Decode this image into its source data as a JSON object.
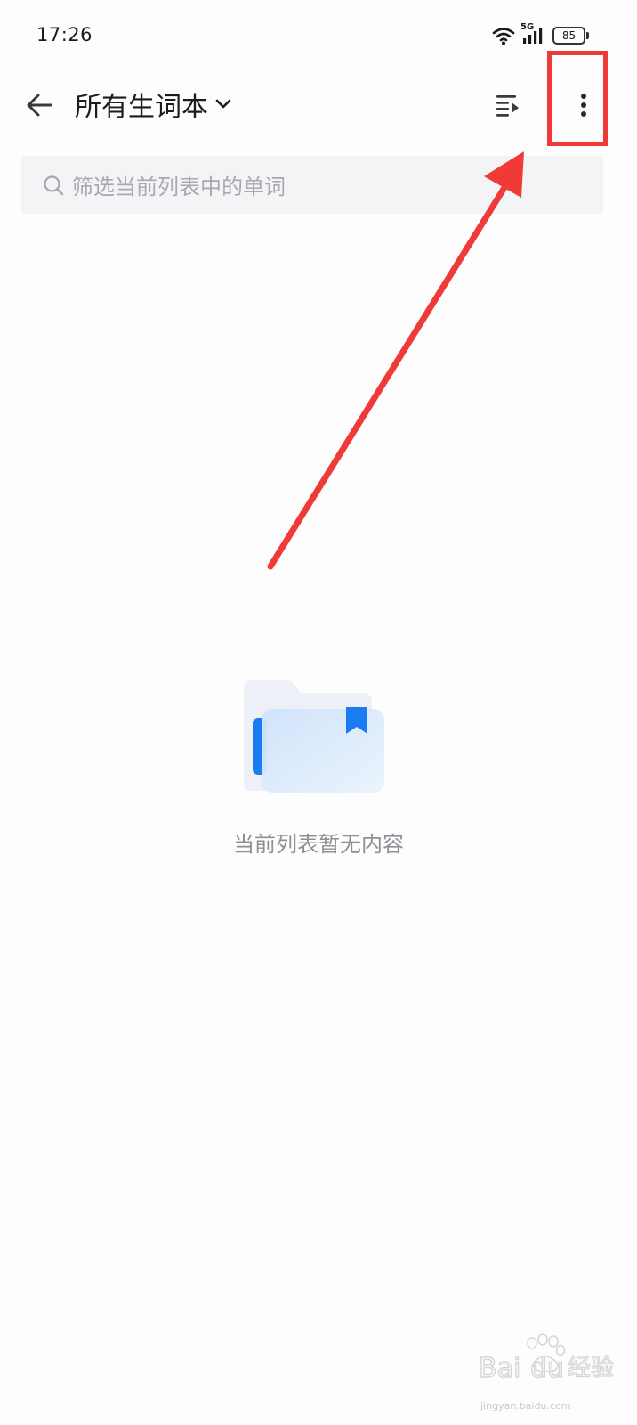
{
  "status_bar": {
    "time": "17:26",
    "network": "5G",
    "battery": "85",
    "icons": [
      "wifi-icon",
      "signal-icon",
      "battery-icon"
    ]
  },
  "header": {
    "back_icon": "arrow-left-icon",
    "title": "所有生词本",
    "title_dropdown_icon": "chevron-down-icon",
    "list_icon": "playlist-icon",
    "more_icon": "more-vertical-icon"
  },
  "search": {
    "placeholder": "筛选当前列表中的单词",
    "icon": "search-icon"
  },
  "empty_state": {
    "illustration": "folder-bookmark-icon",
    "message": "当前列表暂无内容"
  },
  "annotation": {
    "color": "#ef3a37",
    "target": "more-button"
  },
  "watermark": {
    "brand": "Baidu经验",
    "url": "jingyan.baidu.com"
  },
  "colors": {
    "accent_blue": "#1a7cf2",
    "annotation_red": "#ef3a37",
    "search_bg": "#f3f4f6"
  }
}
